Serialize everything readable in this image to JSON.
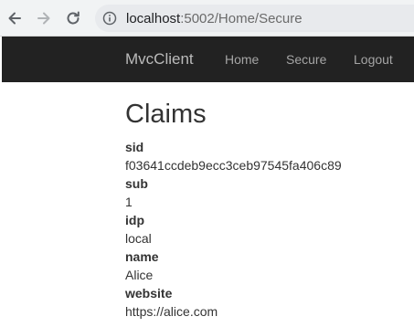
{
  "browser": {
    "url_host": "localhost",
    "url_path": ":5002/Home/Secure"
  },
  "navbar": {
    "brand": "MvcClient",
    "links": [
      {
        "label": "Home"
      },
      {
        "label": "Secure"
      },
      {
        "label": "Logout"
      }
    ]
  },
  "main": {
    "title": "Claims",
    "claims": [
      {
        "type": "sid",
        "value": "f03641ccdeb9ecc3ceb97545fa406c89"
      },
      {
        "type": "sub",
        "value": "1"
      },
      {
        "type": "idp",
        "value": "local"
      },
      {
        "type": "name",
        "value": "Alice"
      },
      {
        "type": "website",
        "value": "https://alice.com"
      }
    ]
  },
  "colors": {
    "navbar_bg": "#222222",
    "browser_bar_bg": "#f1f3f4"
  }
}
